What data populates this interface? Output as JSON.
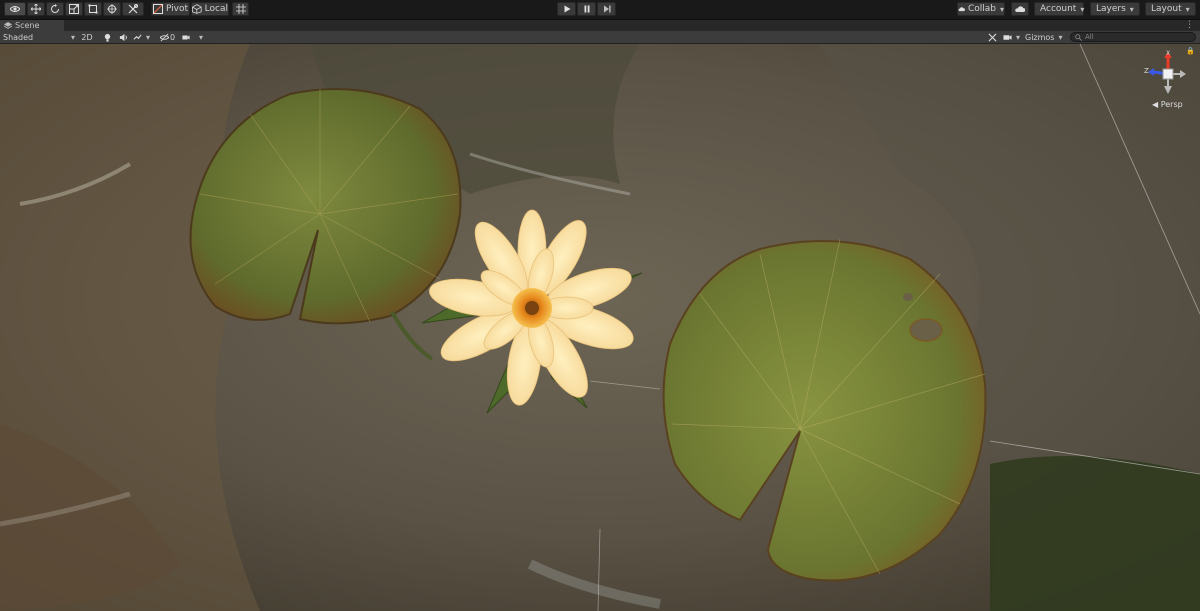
{
  "toolbar": {
    "pivot_label": "Pivot",
    "local_label": "Local",
    "collab_label": "Collab",
    "account_label": "Account",
    "layers_label": "Layers",
    "layout_label": "Layout"
  },
  "tab": {
    "scene_label": "Scene"
  },
  "scene_toolbar": {
    "shading_mode": "Shaded",
    "mode_2d": "2D",
    "hidden_count": "0",
    "gizmos_label": "Gizmos",
    "search_placeholder": "All"
  },
  "viewport": {
    "projection_label": "Persp",
    "gizmo_axis_z": "Z",
    "gizmo_axis_x": "X"
  },
  "colors": {
    "accent": "#3a72b0",
    "toolbar_bg": "#191919",
    "panel_bg": "#3c3c3c"
  }
}
